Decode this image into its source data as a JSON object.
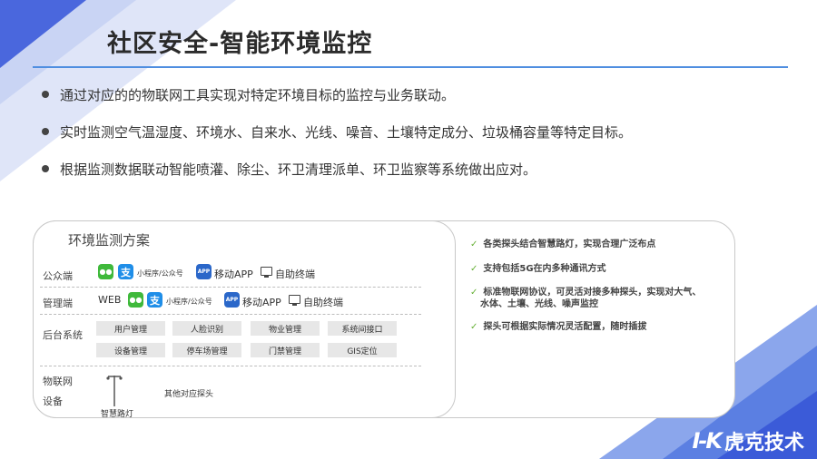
{
  "slide": {
    "title": "社区安全-智能环境监控",
    "bullets": [
      "通过对应的的物联网工具实现对特定环境目标的监控与业务联动。",
      "实时监测空气温湿度、环境水、自来水、光线、噪音、土壤特定成分、垃圾桶容量等特定目标。",
      "根据监测数据联动智能喷灌、除尘、环卫清理派单、环卫监察等系统做出应对。"
    ]
  },
  "diagram": {
    "title": "环境监测方案",
    "public": {
      "label": "公众端",
      "mini_program": "小程序/公众号",
      "mobile_app": "移动APP",
      "terminal": "自助终端"
    },
    "manage": {
      "label": "管理端",
      "web": "WEB",
      "mini_program": "小程序/公众号",
      "mobile_app": "移动APP",
      "terminal": "自助终端"
    },
    "backend": {
      "label": "后台系统",
      "buttons": [
        "用户管理",
        "人脸识别",
        "物业管理",
        "系统间接口",
        "设备管理",
        "停车场管理",
        "门禁管理",
        "GIS定位"
      ]
    },
    "iot": {
      "label_line1": "物联网",
      "label_line2": "设备",
      "streetlight": "智慧路灯",
      "other": "其他对应探头"
    },
    "app_chip": "APP",
    "alipay_chip": "支"
  },
  "features": [
    {
      "text": "各类探头结合智慧路灯，实现合理广泛布点"
    },
    {
      "text": "支持包括5G在内多种通讯方式"
    },
    {
      "text": "标准物联网协议，可灵活对接多种探头，实现对大气、",
      "cont": "水体、土壤、光线、噪声监控"
    },
    {
      "text": "探头可根据实际情况灵活配置，随时插拔"
    }
  ],
  "check_glyph": "✓",
  "logo": {
    "mark": "I-K",
    "name": "虎克技术"
  },
  "colors": {
    "accent": "#4f8ee0",
    "deco_dark": "#3d5fd8",
    "deco_light": "#c9d4f4",
    "check": "#6ab23b"
  }
}
